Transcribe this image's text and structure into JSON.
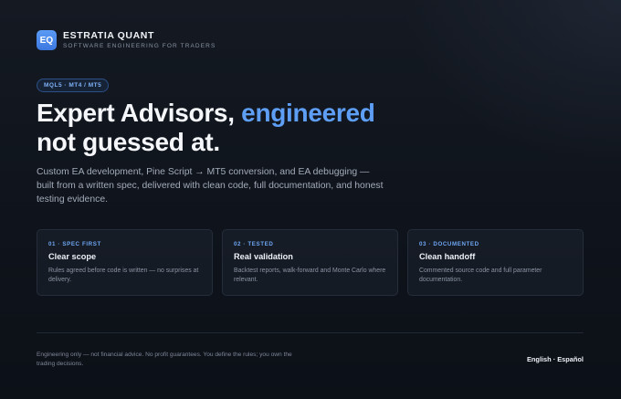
{
  "brand": {
    "logo_text": "EQ",
    "name": "ESTRATIA QUANT",
    "tagline": "SOFTWARE ENGINEERING FOR TRADERS"
  },
  "hero": {
    "badge": "MQL5 · MT4 / MT5",
    "headline_part1": "Expert Advisors, ",
    "headline_accent": "engineered",
    "headline_part2": "not guessed at.",
    "lead": "Custom EA development, Pine Script → MT5 conversion, and EA debugging — built from a written spec, delivered with clean code, full documentation, and honest testing evidence."
  },
  "cards": [
    {
      "kicker": "01 · SPEC FIRST",
      "title": "Clear scope",
      "desc": "Rules agreed before code is written — no surprises at delivery."
    },
    {
      "kicker": "02 · TESTED",
      "title": "Real validation",
      "desc": "Backtest reports, walk-forward and Monte Carlo where relevant."
    },
    {
      "kicker": "03 · DOCUMENTED",
      "title": "Clean handoff",
      "desc": "Commented source code and full parameter documentation."
    }
  ],
  "footer": {
    "disclaimer": "Engineering only — not financial advice. No profit guarantees. You define the rules; you own the trading decisions.",
    "language_switch": "English · Español"
  },
  "colors": {
    "accent": "#5e9ef5",
    "background": "#0f141c"
  }
}
